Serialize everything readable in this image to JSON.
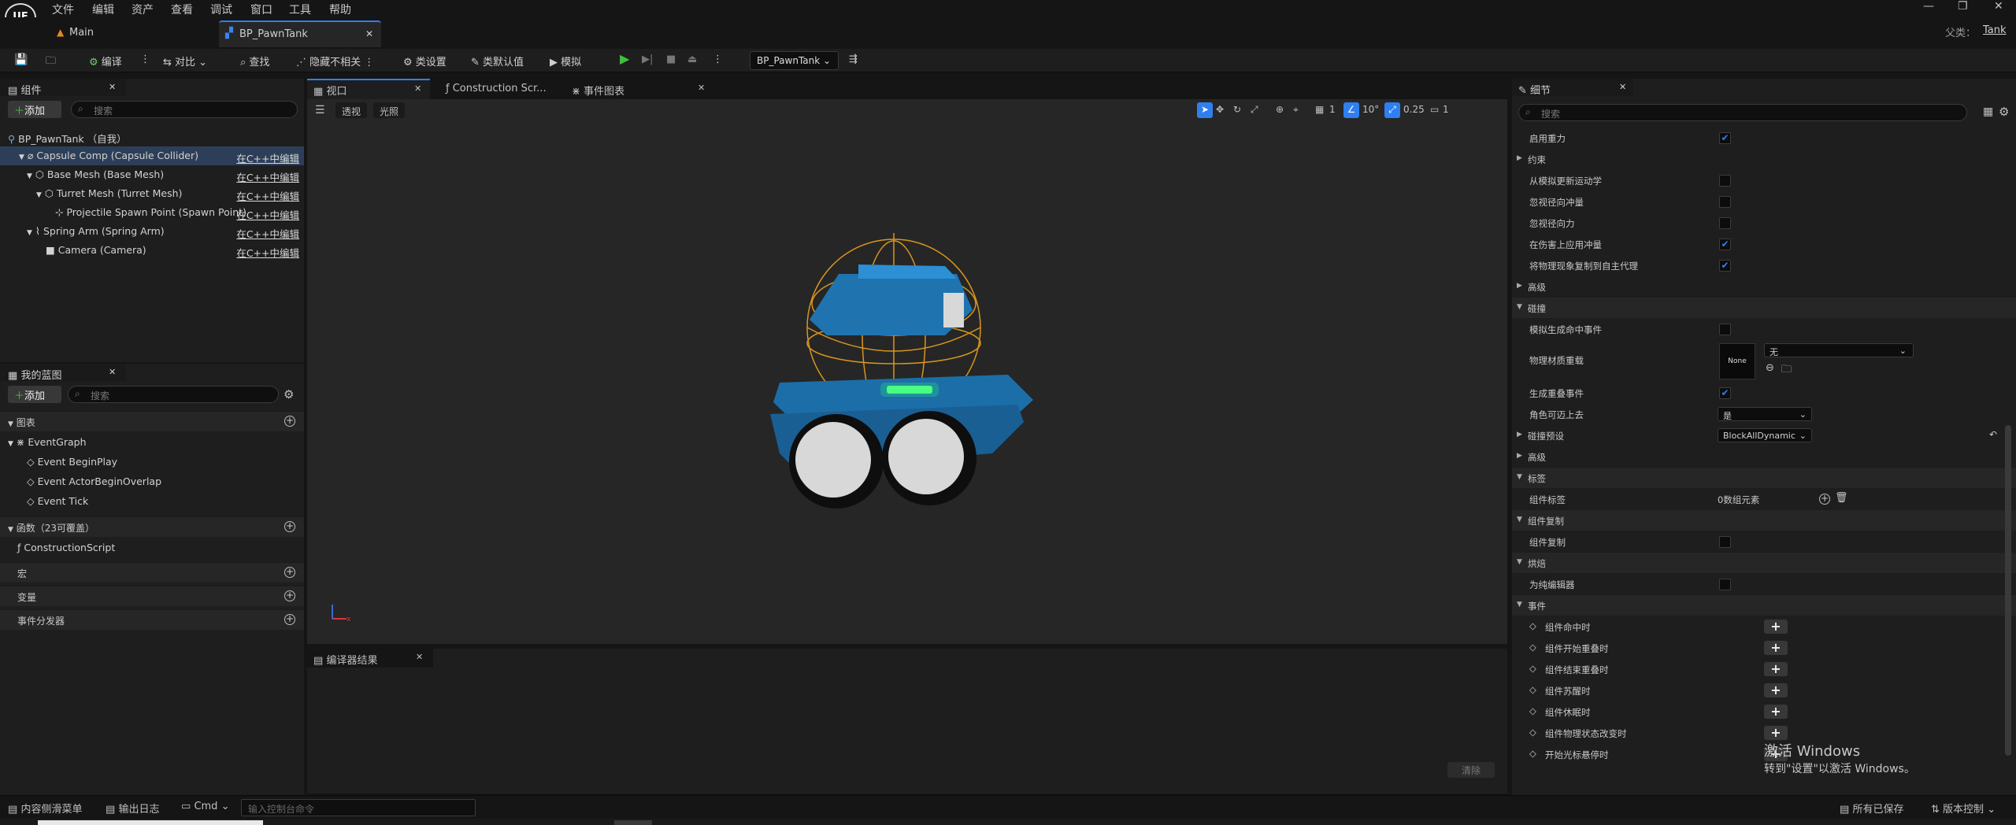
{
  "menu": {
    "logo": "UE",
    "items": [
      "文件",
      "编辑",
      "资产",
      "查看",
      "调试",
      "窗口",
      "工具",
      "帮助"
    ],
    "parent_label": "父类：",
    "parent_value": "Tank",
    "win_min": "—",
    "win_max": "❐",
    "win_close": "✕"
  },
  "tabs": [
    {
      "label": "Main"
    },
    {
      "label": "BP_PawnTank",
      "close": "✕"
    }
  ],
  "toolbar": {
    "compile": "编译",
    "diff": "对比",
    "find": "查找",
    "hide_unrelated": "隐藏不相关",
    "class_settings": "类设置",
    "class_defaults": "类默认值",
    "simulate": "模拟",
    "debug_object": "BP_PawnTank"
  },
  "components": {
    "title": "组件",
    "close": "✕",
    "add": "添加",
    "search_placeholder": "搜索",
    "root": "BP_PawnTank （自我）",
    "edit_label": "在C++中编辑",
    "items": [
      {
        "label": "Capsule Comp (Capsule Collider)",
        "edit": "在C++中编辑"
      },
      {
        "label": "Base Mesh (Base Mesh)",
        "edit": "在C++中编辑"
      },
      {
        "label": "Turret Mesh (Turret Mesh)",
        "edit": "在C++中编辑"
      },
      {
        "label": "Projectile Spawn Point (Spawn Point)",
        "edit": "在C++中编辑"
      },
      {
        "label": "Spring Arm (Spring Arm)",
        "edit": "在C++中编辑"
      },
      {
        "label": "Camera (Camera)",
        "edit": "在C++中编辑"
      }
    ]
  },
  "mybp": {
    "title": "我的蓝图",
    "close": "✕",
    "add": "添加",
    "search_placeholder": "搜索",
    "graphs_header": "图表",
    "event_graph": "EventGraph",
    "events": [
      "Event BeginPlay",
      "Event ActorBeginOverlap",
      "Event Tick"
    ],
    "functions_header": "函数（23可覆盖）",
    "construction_script": "ConstructionScript",
    "macros_header": "宏",
    "variables_header": "变量",
    "dispatchers_header": "事件分发器"
  },
  "center_tabs": [
    {
      "label": "视口",
      "close": "✕"
    },
    {
      "label": "Construction Scr...",
      "close": "✕"
    },
    {
      "label": "事件图表"
    }
  ],
  "viewport": {
    "perspective": "透视",
    "lit": "光照",
    "grid_value": "1",
    "rot_value": "10°",
    "scale_value": "0.25",
    "cam_speed": "1"
  },
  "compiler": {
    "title": "编译器结果",
    "close": "✕",
    "clear": "清除"
  },
  "details": {
    "title": "细节",
    "close": "✕",
    "search_placeholder": "搜索",
    "rows": [
      {
        "label": "启用重力",
        "type": "check",
        "checked": true
      },
      {
        "label": "约束",
        "type": "group"
      },
      {
        "label": "从模拟更新运动学",
        "type": "check",
        "checked": false
      },
      {
        "label": "忽视径向冲量",
        "type": "check",
        "checked": false
      },
      {
        "label": "忽视径向力",
        "type": "check",
        "checked": false
      },
      {
        "label": "在伤害上应用冲量",
        "type": "check",
        "checked": true
      },
      {
        "label": "将物理现象复制到自主代理",
        "type": "check",
        "checked": true
      },
      {
        "label": "高级",
        "type": "group"
      },
      {
        "label": "碰撞",
        "type": "section"
      },
      {
        "label": "模拟生成命中事件",
        "type": "check",
        "checked": false
      }
    ],
    "phys_mat_label": "物理材质重载",
    "phys_mat_thumb": "None",
    "phys_mat_value": "无",
    "rows2": [
      {
        "label": "生成重叠事件",
        "type": "check",
        "checked": true
      },
      {
        "label": "角色可迈上去",
        "type": "dropdown",
        "value": "是"
      },
      {
        "label": "碰撞预设",
        "type": "dropdown",
        "value": "BlockAllDynamic",
        "group": true
      },
      {
        "label": "高级",
        "type": "group"
      },
      {
        "label": "标签",
        "type": "section"
      },
      {
        "label": "组件标签",
        "type": "array",
        "value": "0数组元素"
      },
      {
        "label": "组件复制",
        "type": "section"
      },
      {
        "label": "组件复制",
        "type": "check",
        "checked": false
      },
      {
        "label": "烘焙",
        "type": "section"
      },
      {
        "label": "为纯编辑器",
        "type": "check",
        "checked": false
      },
      {
        "label": "事件",
        "type": "section"
      }
    ],
    "events": [
      "组件命中时",
      "组件开始重叠时",
      "组件结束重叠时",
      "组件苏醒时",
      "组件休眠时",
      "组件物理状态改变时",
      "开始光标悬停时"
    ]
  },
  "watermark": {
    "line1": "激活 Windows",
    "line2": "转到\"设置\"以激活 Windows。"
  },
  "statusbar": {
    "content_drawer": "内容侧滑菜单",
    "output_log": "输出日志",
    "cmd": "Cmd",
    "console_placeholder": "输入控制台命令",
    "saved": "所有已保存",
    "source_control": "版本控制"
  },
  "colors": {
    "accent": "#2f7ff0",
    "play": "#3fbf3f",
    "bg": "#151515",
    "panel": "#1e1e1e",
    "viewport": "#262626"
  }
}
